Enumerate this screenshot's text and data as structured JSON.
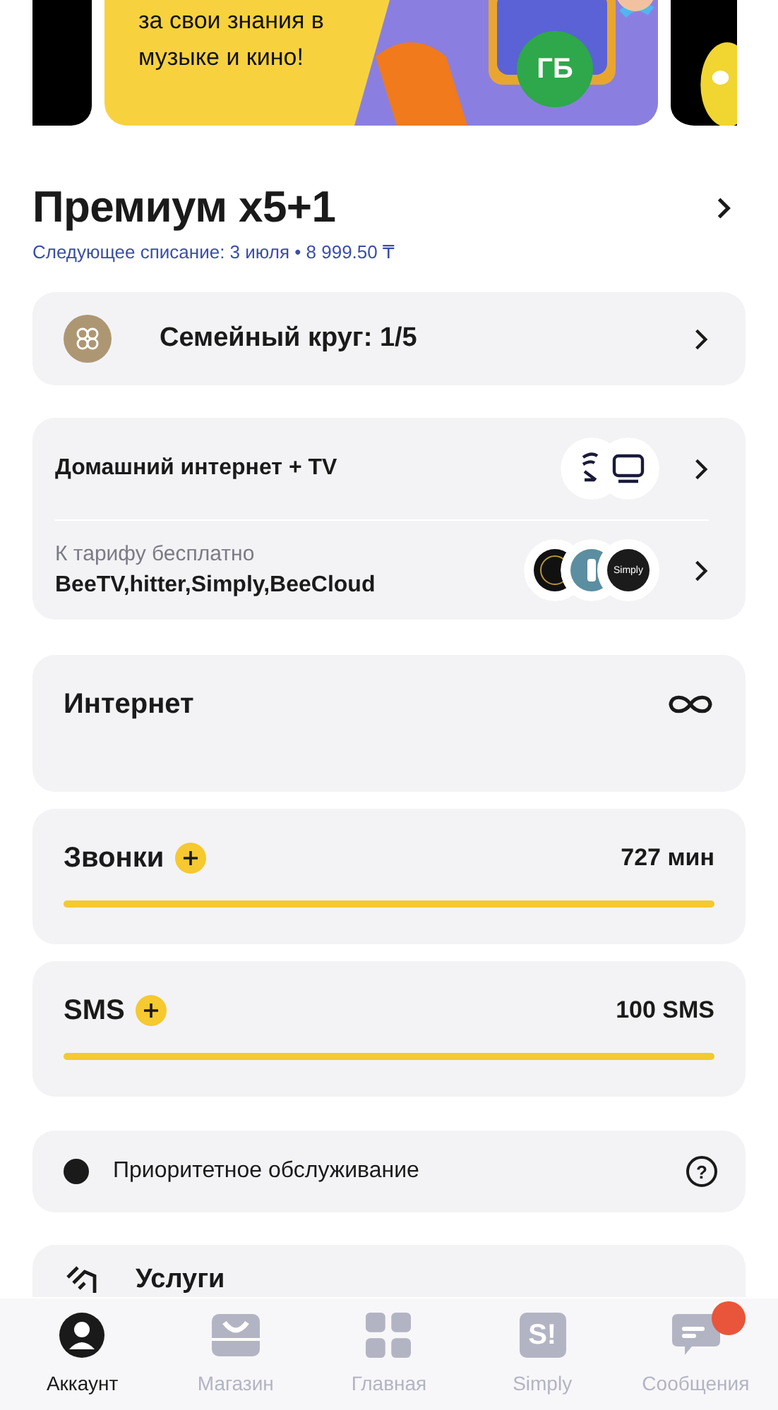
{
  "banner": {
    "text_lines": [
      "за свои знания в",
      "музыке и кино!"
    ],
    "badge": "ГБ"
  },
  "tariff": {
    "title": "Премиум x5+1",
    "subtitle": "Следующее списание: 3 июля • 8 999.50 ₸"
  },
  "family": {
    "label": "Семейный круг: 1/5"
  },
  "home": {
    "title": "Домашний интернет + TV",
    "free_label": "К тарифу бесплатно",
    "free_services": "BeeTV,hitter,Simply,BeeCloud",
    "simply_logo": "Simply"
  },
  "balances": [
    {
      "kind": "unlimited",
      "name": "Интернет"
    },
    {
      "kind": "meter",
      "name": "Звонки",
      "value": "727 мин",
      "level": 1
    },
    {
      "kind": "meter",
      "name": "SMS",
      "value": "100 SMS",
      "level": 1
    }
  ],
  "priority": {
    "label": "Приоритетное обслуживание",
    "help": "?"
  },
  "services": {
    "label": "Услуги"
  },
  "tabs": [
    {
      "label": "Аккаунт",
      "kind": "account",
      "selected": true,
      "badge": false
    },
    {
      "label": "Магазин",
      "kind": "shop",
      "selected": false,
      "badge": false
    },
    {
      "label": "Главная",
      "kind": "home",
      "selected": false,
      "badge": false
    },
    {
      "label": "Simply",
      "kind": "simply",
      "glyph": "S!",
      "selected": false,
      "badge": false
    },
    {
      "label": "Сообщения",
      "kind": "messages",
      "selected": false,
      "badge": true
    }
  ]
}
